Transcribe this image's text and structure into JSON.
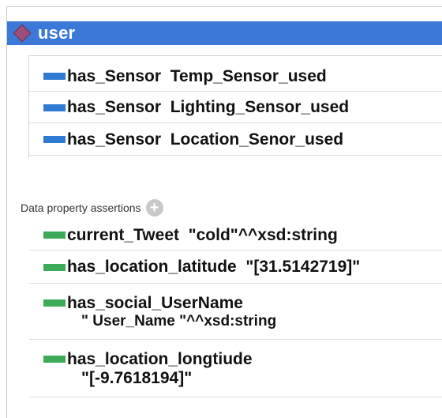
{
  "header": {
    "title": "user"
  },
  "object_properties": [
    {
      "property": "has_Sensor",
      "value": "Temp_Sensor_used"
    },
    {
      "property": "has_Sensor",
      "value": "Lighting_Sensor_used"
    },
    {
      "property": "has_Sensor",
      "value": "Location_Senor_used"
    }
  ],
  "data_section": {
    "label": "Data property assertions"
  },
  "data_properties": [
    {
      "property": "current_Tweet",
      "value": "\"cold\"^^xsd:string"
    },
    {
      "property": "has_location_latitude",
      "value": "\"[31.5142719]\""
    },
    {
      "property": "has_social_UserName",
      "value": "\" User_Name \"^^xsd:string"
    },
    {
      "property": "has_location_longtiude",
      "value": "\"[-9.7618194]\""
    }
  ],
  "colors": {
    "header_bg": "#3c78d8",
    "object_bar": "#2f7bd3",
    "data_bar": "#3daa5a"
  }
}
